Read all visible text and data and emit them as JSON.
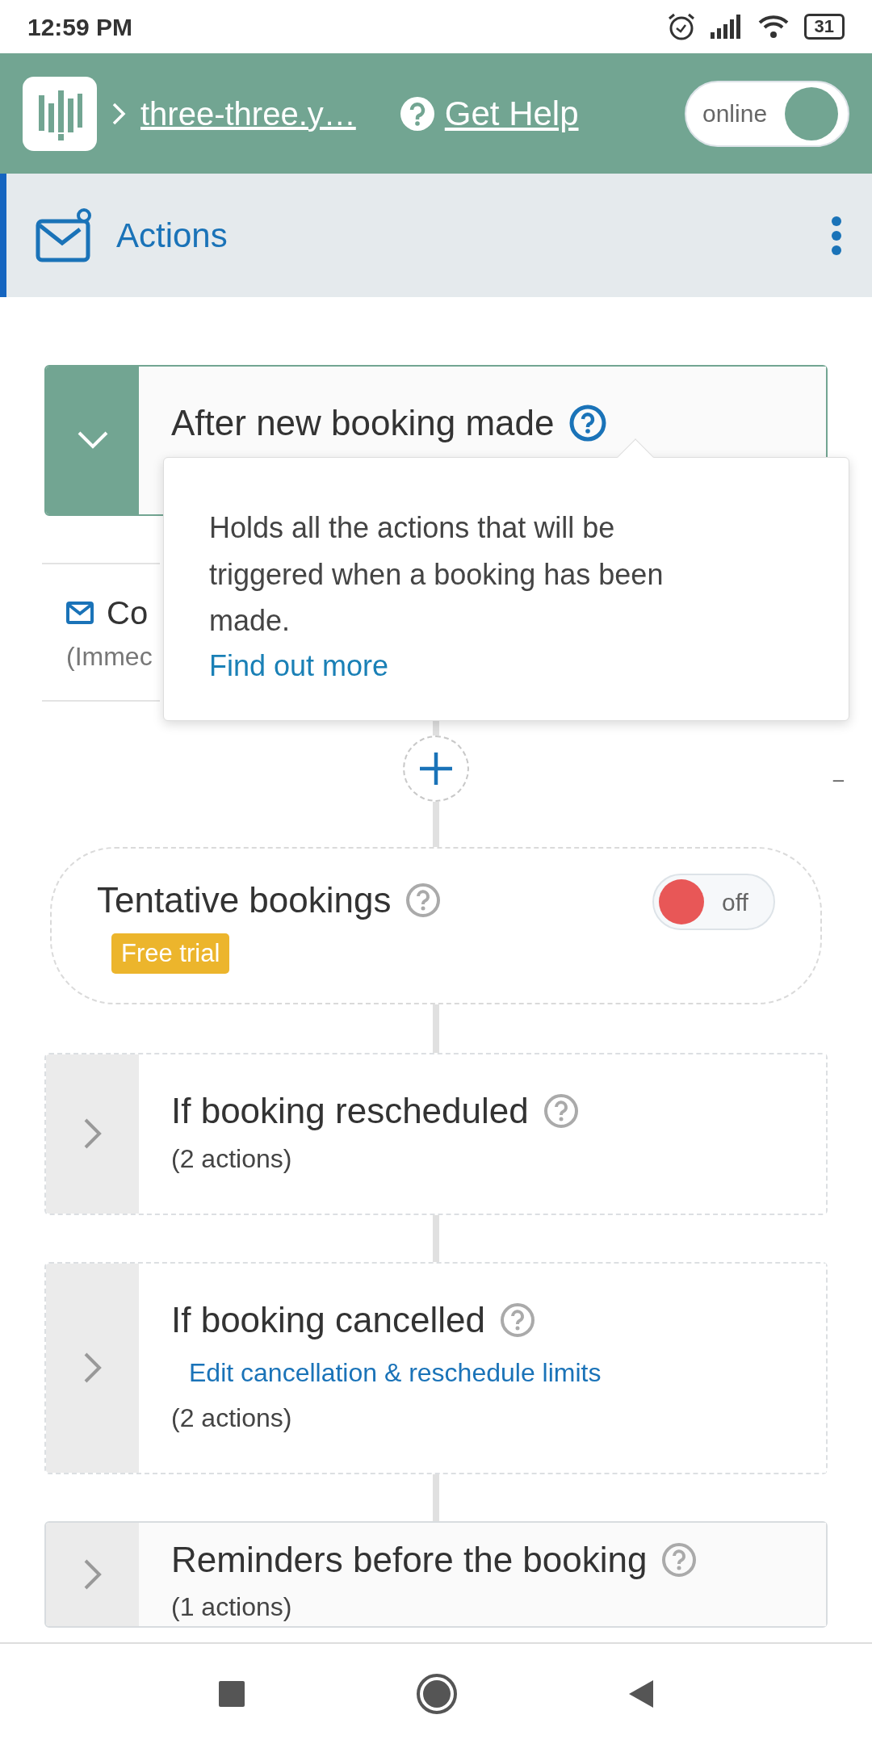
{
  "status_bar": {
    "time": "12:59 PM",
    "battery": "31"
  },
  "header": {
    "site": "three-three.y…",
    "help": "Get Help",
    "status_toggle": {
      "label": "online",
      "on": true
    }
  },
  "section": {
    "title": "Actions"
  },
  "flow": [
    {
      "kind": "group",
      "title": "After new booking made",
      "expanded": true,
      "active": true,
      "help_open": true
    },
    {
      "kind": "action",
      "title": "Co",
      "subtitle": "(Immec"
    },
    {
      "kind": "add",
      "mark": "–"
    },
    {
      "kind": "toggle",
      "title": "Tentative bookings",
      "badge": "Free trial",
      "toggle": {
        "label": "off",
        "on": false
      }
    },
    {
      "kind": "group",
      "title": "If booking rescheduled",
      "expanded": false,
      "active": false,
      "help_open": false,
      "count": "(2 actions)"
    },
    {
      "kind": "group",
      "title": "If booking cancelled",
      "expanded": false,
      "active": false,
      "help_open": false,
      "link": "Edit cancellation & reschedule limits",
      "count": "(2 actions)"
    },
    {
      "kind": "group",
      "title": "Reminders before the booking",
      "expanded": false,
      "active": true,
      "help_open": false,
      "count": "(1 actions)"
    }
  ],
  "tooltip": {
    "text": "Holds all the actions that will be triggered when a booking has been made.",
    "link": "Find out more"
  }
}
